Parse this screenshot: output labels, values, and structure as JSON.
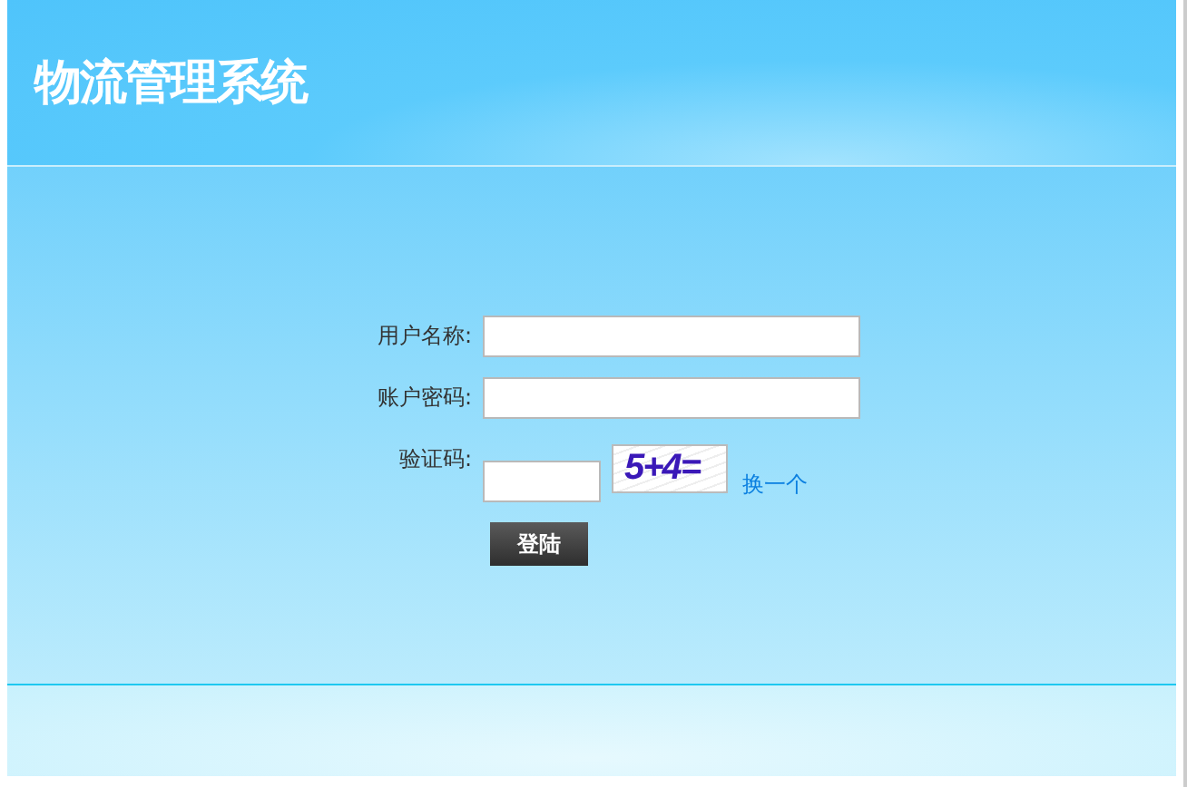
{
  "header": {
    "title": "物流管理系统"
  },
  "form": {
    "fields": [
      {
        "label": "用户名称:",
        "kind": "text"
      },
      {
        "label": "账户密码:",
        "kind": "password"
      },
      {
        "label": "验证码:",
        "kind": "captcha",
        "captcha": "5+4=",
        "refresh": "换一个"
      }
    ],
    "submit": "登陆"
  }
}
